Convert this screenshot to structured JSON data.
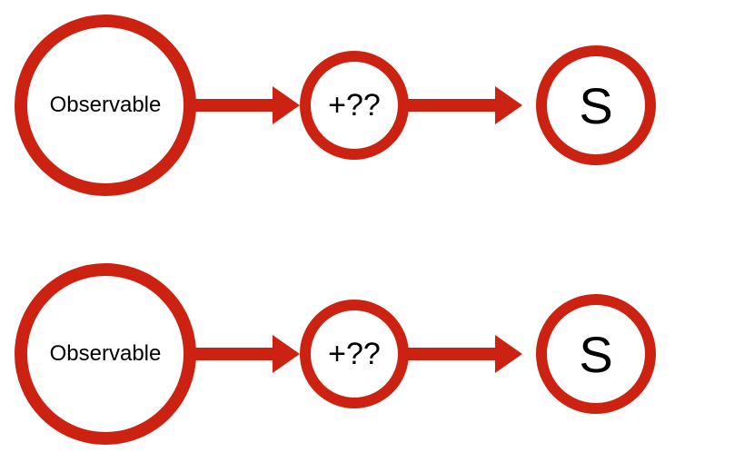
{
  "colors": {
    "accent": "#cb2212"
  },
  "rows": [
    {
      "source": "Observable",
      "operator": "+??",
      "sink": "S"
    },
    {
      "source": "Observable",
      "operator": "+??",
      "sink": "S"
    }
  ]
}
